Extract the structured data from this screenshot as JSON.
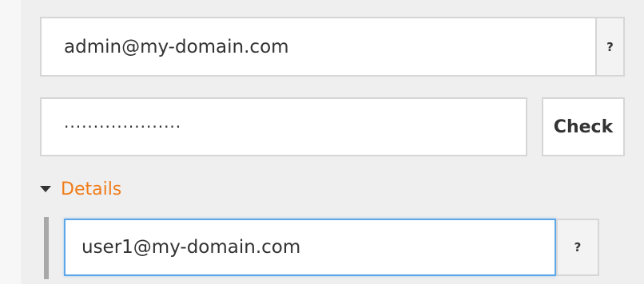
{
  "form": {
    "email_field": {
      "value": "admin@my-domain.com",
      "help_label": "?"
    },
    "password_field": {
      "value": "····················",
      "check_label": "Check"
    },
    "details": {
      "label": "Details",
      "state": "expanded",
      "email_field": {
        "value": "user1@my-domain.com",
        "help_label": "?",
        "focused": true
      }
    }
  },
  "colors": {
    "background": "#efefef",
    "input_border": "#d6d6d6",
    "focus_border": "#5ea8ea",
    "details_label": "#f07d1a",
    "rule": "#a8a8a8"
  },
  "icons": {
    "details_toggle": "caret-down-icon"
  }
}
